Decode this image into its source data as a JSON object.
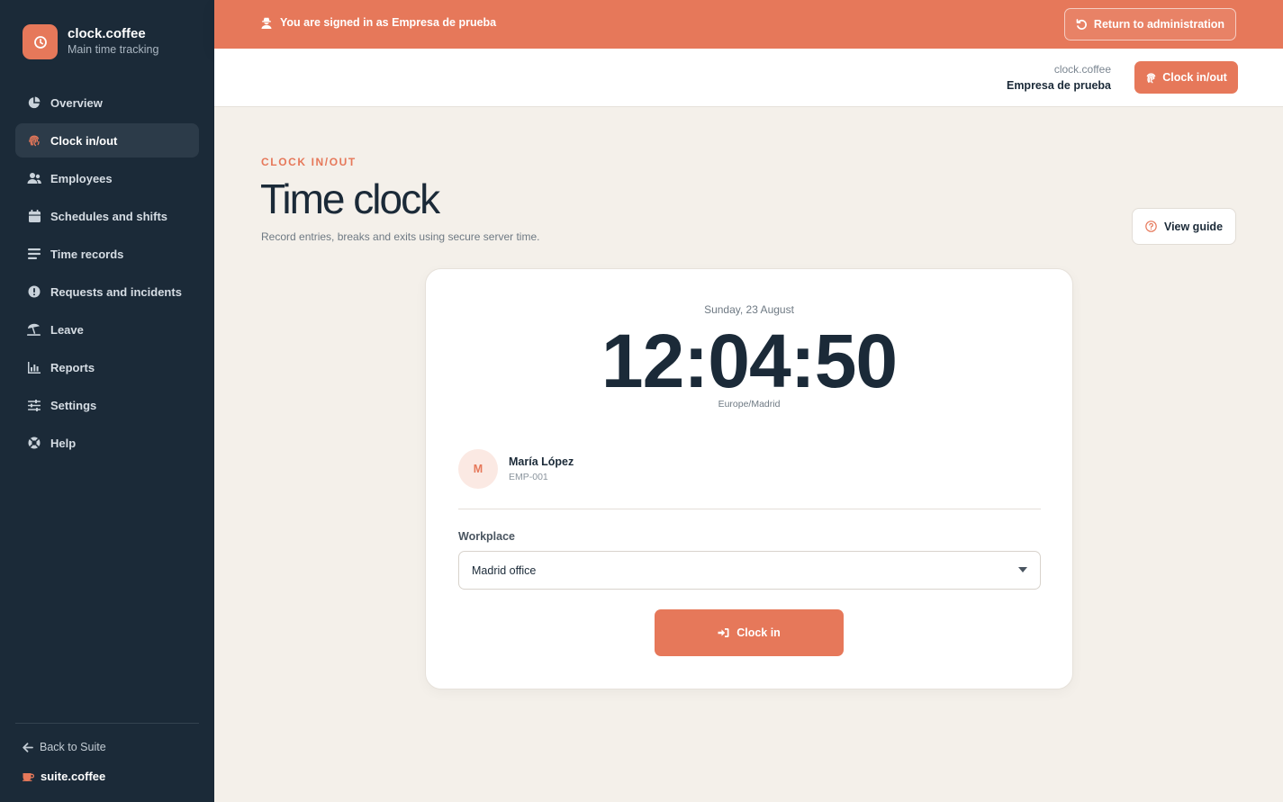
{
  "brand": {
    "name": "clock.coffee",
    "subtitle": "Main time tracking"
  },
  "sidebar": {
    "items": [
      {
        "label": "Overview",
        "icon": "pie-chart-icon"
      },
      {
        "label": "Clock in/out",
        "icon": "fingerprint-icon",
        "active": true
      },
      {
        "label": "Employees",
        "icon": "users-icon"
      },
      {
        "label": "Schedules and shifts",
        "icon": "calendar-icon"
      },
      {
        "label": "Time records",
        "icon": "list-icon"
      },
      {
        "label": "Requests and incidents",
        "icon": "alert-circle-icon"
      },
      {
        "label": "Leave",
        "icon": "umbrella-beach-icon"
      },
      {
        "label": "Reports",
        "icon": "bar-chart-icon"
      },
      {
        "label": "Settings",
        "icon": "sliders-icon"
      },
      {
        "label": "Help",
        "icon": "lifebuoy-icon"
      }
    ],
    "back_label": "Back to Suite",
    "suite_label": "suite.coffee"
  },
  "banner": {
    "text": "You are signed in as Empresa de prueba",
    "return_label": "Return to administration"
  },
  "topbar": {
    "app_name": "clock.coffee",
    "company_name": "Empresa de prueba",
    "clock_button": "Clock in/out"
  },
  "page": {
    "eyebrow": "CLOCK IN/OUT",
    "title": "Time clock",
    "subtitle": "Record entries, breaks and exits using secure server time.",
    "guide_label": "View guide"
  },
  "clock": {
    "date": "Sunday, 23 August",
    "time": "12:04:50",
    "timezone": "Europe/Madrid"
  },
  "employee": {
    "initial": "M",
    "name": "María López",
    "code": "EMP-001"
  },
  "workplace": {
    "label": "Workplace",
    "selected": "Madrid office"
  },
  "action": {
    "clock_in_label": "Clock in"
  },
  "colors": {
    "accent": "#e6785a",
    "sidebar": "#1b2a38",
    "background": "#f4f0ea"
  }
}
